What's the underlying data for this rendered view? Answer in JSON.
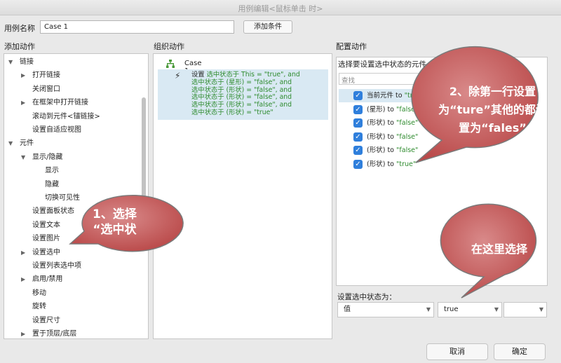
{
  "window": {
    "title": "用例编辑<鼠标单击 时>"
  },
  "case_name": {
    "label": "用例名称",
    "value": "Case 1",
    "add_condition": "添加条件"
  },
  "columns": {
    "left": "添加动作",
    "middle": "组织动作",
    "right": "配置动作"
  },
  "tree": [
    {
      "label": "链接",
      "level": 0,
      "arrow": "down"
    },
    {
      "label": "打开链接",
      "level": 1,
      "arrow": "right"
    },
    {
      "label": "关闭窗口",
      "level": 1,
      "arrow": ""
    },
    {
      "label": "在框架中打开链接",
      "level": 1,
      "arrow": "right"
    },
    {
      "label": "滚动到元件<锚链接>",
      "level": 1,
      "arrow": ""
    },
    {
      "label": "设置自适应视图",
      "level": 1,
      "arrow": ""
    },
    {
      "label": "元件",
      "level": 0,
      "arrow": "down"
    },
    {
      "label": "显示/隐藏",
      "level": 1,
      "arrow": "down"
    },
    {
      "label": "显示",
      "level": 2,
      "arrow": ""
    },
    {
      "label": "隐藏",
      "level": 2,
      "arrow": ""
    },
    {
      "label": "切换可见性",
      "level": 2,
      "arrow": ""
    },
    {
      "label": "设置面板状态",
      "level": 1,
      "arrow": ""
    },
    {
      "label": "设置文本",
      "level": 1,
      "arrow": ""
    },
    {
      "label": "设置图片",
      "level": 1,
      "arrow": ""
    },
    {
      "label": "设置选中",
      "level": 1,
      "arrow": "right"
    },
    {
      "label": "设置列表选中项",
      "level": 1,
      "arrow": ""
    },
    {
      "label": "启用/禁用",
      "level": 1,
      "arrow": "right"
    },
    {
      "label": "移动",
      "level": 1,
      "arrow": ""
    },
    {
      "label": "旋转",
      "level": 1,
      "arrow": ""
    },
    {
      "label": "设置尺寸",
      "level": 1,
      "arrow": ""
    },
    {
      "label": "置于顶层/底层",
      "level": 1,
      "arrow": "right"
    }
  ],
  "organize": {
    "case_label": "Case 1",
    "action_lines": [
      [
        "设置",
        "选中状态于 This = \"true\", and"
      ],
      [
        "",
        "选中状态于 (星形) = \"false\", and"
      ],
      [
        "",
        "选中状态于 (形状) = \"false\", and"
      ],
      [
        "",
        "选中状态于 (形状) = \"false\", and"
      ],
      [
        "",
        "选中状态于 (形状) = \"false\", and"
      ],
      [
        "",
        "选中状态于 (形状) = \"true\""
      ]
    ]
  },
  "config": {
    "select_title": "选择要设置选中状态的元件",
    "search_placeholder": "查找",
    "items": [
      {
        "name": "当前元件",
        "to": "to",
        "value": "\"true\"",
        "selected": true
      },
      {
        "name": "(星形)",
        "to": "to",
        "value": "\"false\"",
        "selected": false
      },
      {
        "name": "(形状)",
        "to": "to",
        "value": "\"false\"",
        "selected": false
      },
      {
        "name": "(形状)",
        "to": "to",
        "value": "\"false\"",
        "selected": false
      },
      {
        "name": "(形状)",
        "to": "to",
        "value": "\"false\"",
        "selected": false
      },
      {
        "name": "(形状)",
        "to": "to",
        "value": "\"true\"",
        "selected": false
      }
    ],
    "set_label": "设置选中状态为：",
    "dropdown_mode": "值",
    "dropdown_value": "true",
    "dropdown_extra": ""
  },
  "buttons": {
    "cancel": "取消",
    "ok": "确定"
  },
  "annotations": {
    "bubble1_line1": "1、选择",
    "bubble1_line2": "“选中状",
    "bubble2_line1": "2、除第一行设置",
    "bubble2_line2": "为“ture”其他的都设",
    "bubble2_line3": "置为“fales”",
    "bubble3": "在这里选择"
  },
  "colors": {
    "bubble_fill": "#c55a5a",
    "selection": "#d9e9f3",
    "checkbox": "#2f7fdc",
    "value_green": "#2e8b2e"
  }
}
